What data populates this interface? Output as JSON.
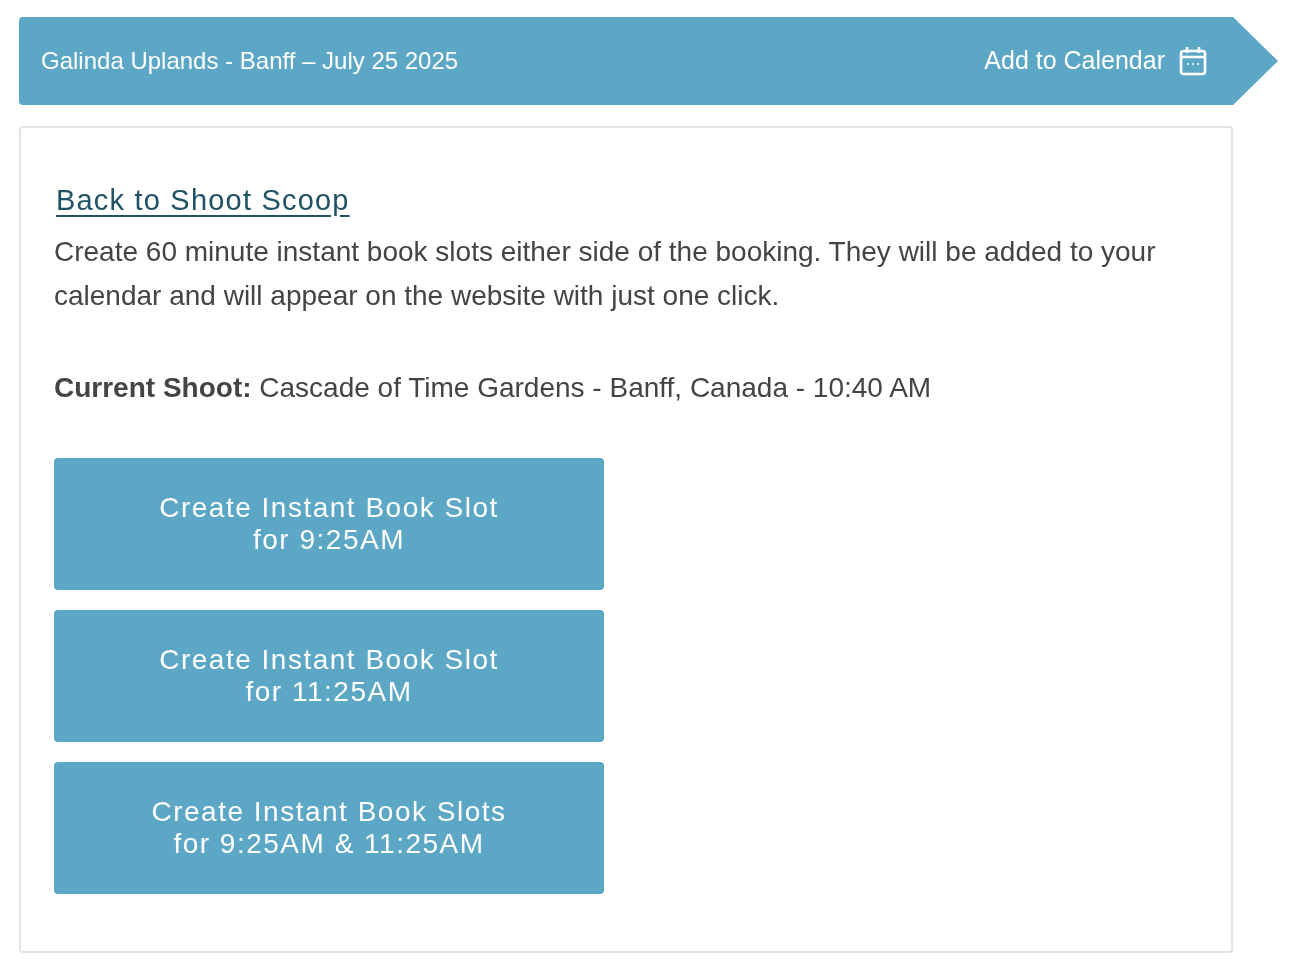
{
  "header": {
    "title": "Galinda Uplands - Banff – July 25 2025",
    "action": "Add to Calendar"
  },
  "back_link": "Back to Shoot Scoop",
  "description": "Create 60 minute instant book slots either side of the booking. They will be added to your calendar and will appear on the website with just one click.",
  "current_shoot": "**Current Shoot:** Cascade of Time Gardens - Banff, Canada - 10:40 AM",
  "buttons": [
    {
      "label": "Create Instant Book Slot\nfor 9:25AM"
    },
    {
      "label": "Create Instant Book Slot\nfor 11:25AM"
    },
    {
      "label": "Create Instant Book Slots\nfor 9:25AM & 11:25AM"
    }
  ]
}
